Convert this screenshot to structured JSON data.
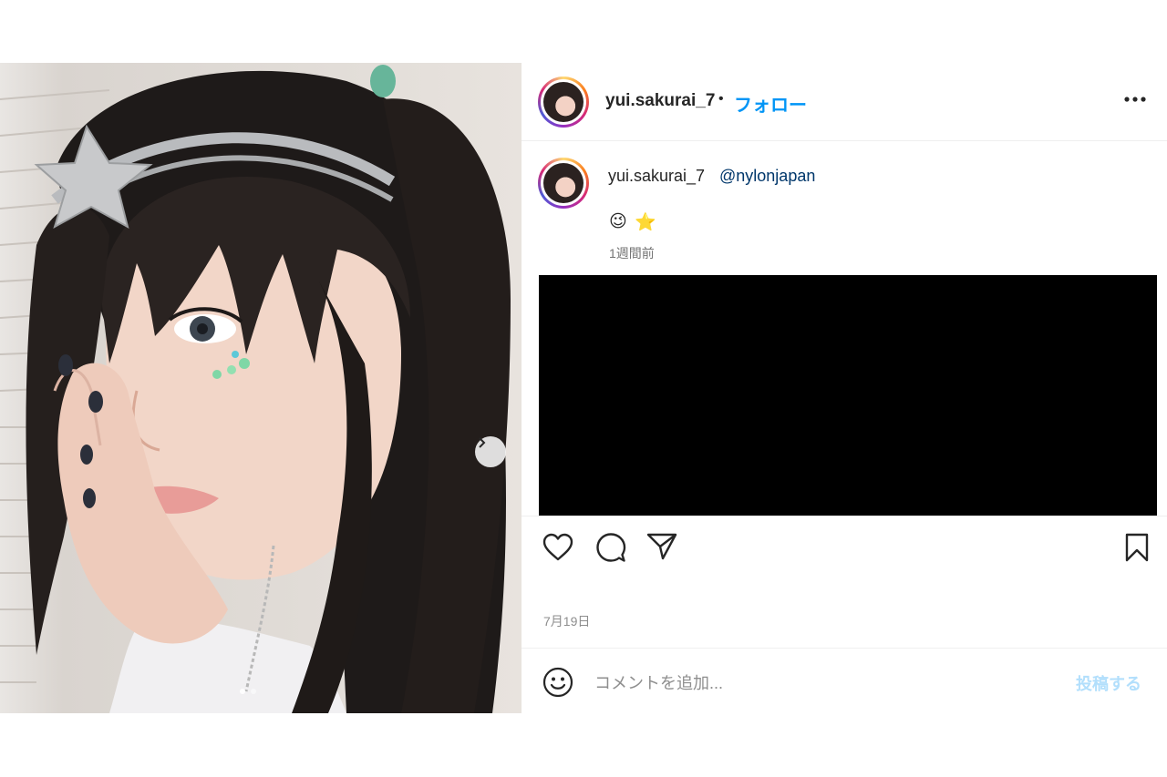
{
  "header": {
    "username": "yui.sakurai_7",
    "separator": "•",
    "follow_label": "フォロー",
    "more_icon": "more-horizontal-icon"
  },
  "caption": {
    "username": "yui.sakurai_7",
    "mention": "@nylonjapan",
    "emojis": [
      "😉",
      "⭐"
    ],
    "time_ago": "1週間前"
  },
  "actions": {
    "like_icon": "heart-icon",
    "comment_icon": "comment-icon",
    "share_icon": "paper-plane-icon",
    "save_icon": "bookmark-icon"
  },
  "post_date": "7月19日",
  "comment": {
    "emoji_icon": "smiley-icon",
    "placeholder": "コメントを追加...",
    "post_label": "投稿する"
  },
  "carousel": {
    "next_icon": "chevron-right-icon"
  },
  "colors": {
    "follow_blue": "#0095f6",
    "post_disabled": "#b2dffc",
    "mention_blue": "#00376b",
    "secondary_text": "#8e8e8e"
  }
}
